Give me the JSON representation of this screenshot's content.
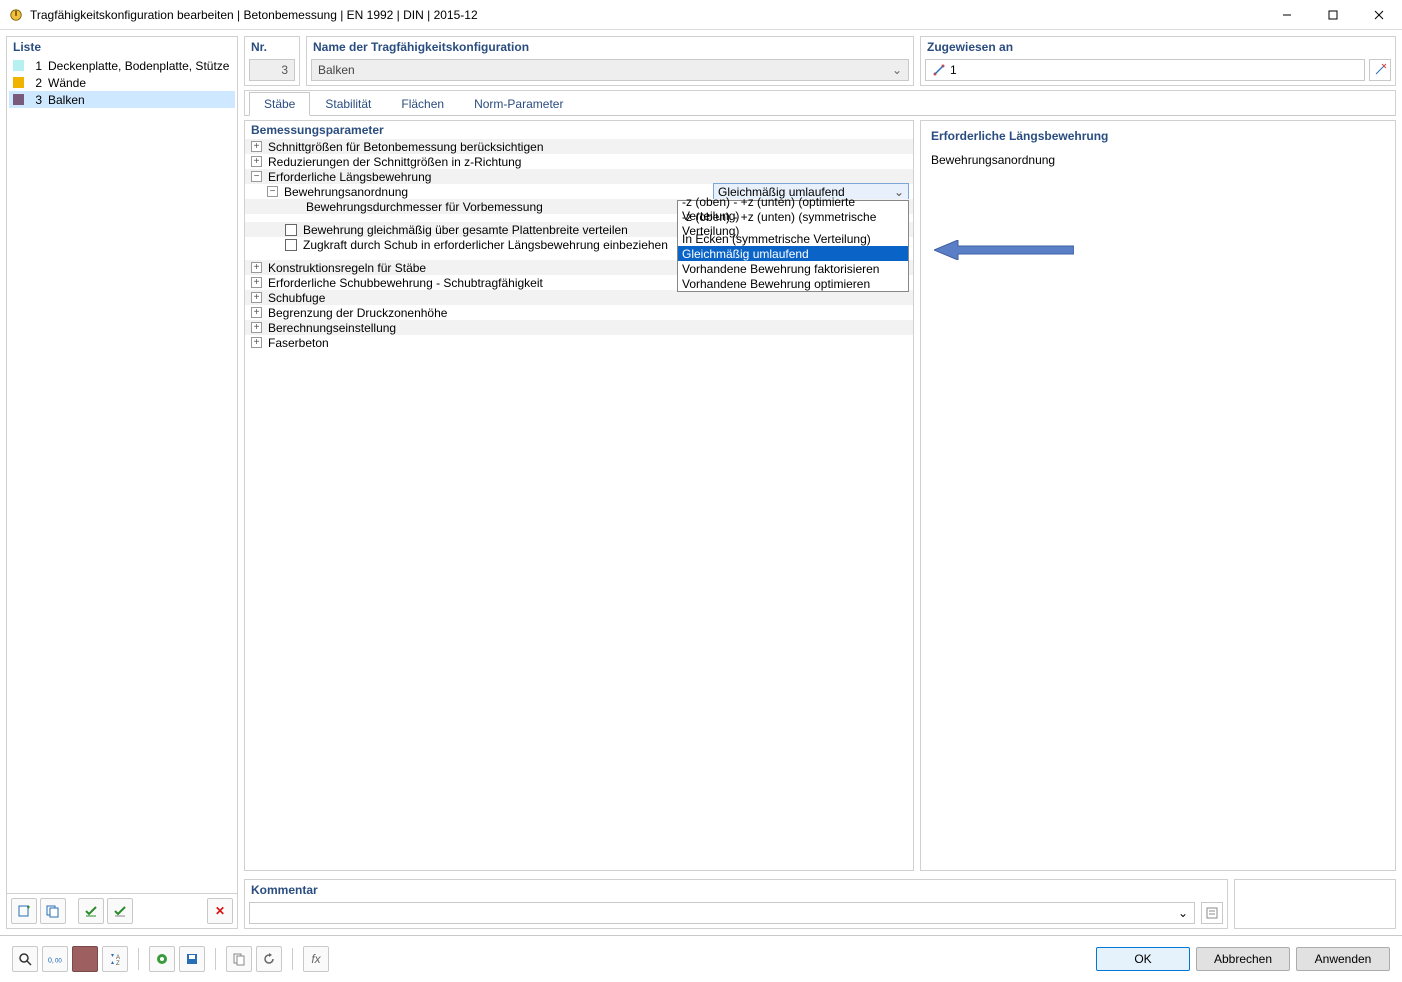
{
  "window": {
    "title": "Tragfähigkeitskonfiguration bearbeiten | Betonbemessung | EN 1992 | DIN | 2015-12"
  },
  "left": {
    "header": "Liste",
    "items": [
      {
        "num": "1",
        "label": "Deckenplatte, Bodenplatte, Stütze",
        "color": "#b6f0f0",
        "selected": false
      },
      {
        "num": "2",
        "label": "Wände",
        "color": "#f0b300",
        "selected": false
      },
      {
        "num": "3",
        "label": "Balken",
        "color": "#7a5a7a",
        "selected": true
      }
    ]
  },
  "nr": {
    "header": "Nr.",
    "value": "3"
  },
  "name": {
    "header": "Name der Tragfähigkeitskonfiguration",
    "value": "Balken"
  },
  "assigned": {
    "header": "Zugewiesen an",
    "value": "1"
  },
  "tabs": {
    "items": [
      {
        "id": "staebe",
        "label": "Stäbe",
        "active": true
      },
      {
        "id": "stabilitaet",
        "label": "Stabilität",
        "active": false
      },
      {
        "id": "flaechen",
        "label": "Flächen",
        "active": false
      },
      {
        "id": "norm",
        "label": "Norm-Parameter",
        "active": false
      }
    ]
  },
  "params": {
    "header": "Bemessungsparameter",
    "rows": {
      "r1": "Schnittgrößen für Betonbemessung berücksichtigen",
      "r2": "Reduzierungen der Schnittgrößen in z-Richtung",
      "r3": "Erforderliche Längsbewehrung",
      "r3a": "Bewehrungsanordnung",
      "r3a1": "Bewehrungsdurchmesser für Vorbemessung",
      "r3b": "Bewehrung gleichmäßig über gesamte Plattenbreite verteilen",
      "r3c": "Zugkraft durch Schub in erforderlicher Längsbewehrung einbeziehen",
      "r4": "Konstruktionsregeln für Stäbe",
      "r5": "Erforderliche Schubbewehrung - Schubtragfähigkeit",
      "r6": "Schubfuge",
      "r7": "Begrenzung der Druckzonenhöhe",
      "r8": "Berechnungseinstellung",
      "r9": "Faserbeton"
    },
    "dd_selected": "Gleichmäßig umlaufend",
    "dd_options": [
      "-z (oben) - +z (unten) (optimierte Verteilung)",
      "-z (oben) - +z (unten) (symmetrische Verteilung)",
      "In Ecken (symmetrische Verteilung)",
      "Gleichmäßig umlaufend",
      "Vorhandene Bewehrung faktorisieren",
      "Vorhandene Bewehrung optimieren"
    ]
  },
  "preview": {
    "title": "Erforderliche Längsbewehrung",
    "subtitle": "Bewehrungsanordnung"
  },
  "comment": {
    "header": "Kommentar",
    "value": ""
  },
  "footer": {
    "ok": "OK",
    "cancel": "Abbrechen",
    "apply": "Anwenden"
  }
}
